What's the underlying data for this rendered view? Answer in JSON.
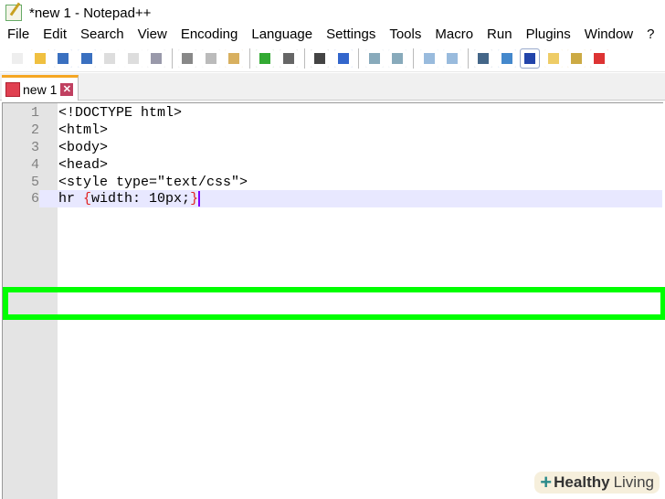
{
  "title": "*new 1 - Notepad++",
  "menu": [
    "File",
    "Edit",
    "Search",
    "View",
    "Encoding",
    "Language",
    "Settings",
    "Tools",
    "Macro",
    "Run",
    "Plugins",
    "Window",
    "?"
  ],
  "toolbar_groups": [
    [
      "new-file-icon",
      "open-file-icon",
      "save-icon",
      "save-all-icon",
      "close-icon",
      "close-all-icon",
      "print-icon"
    ],
    [
      "cut-icon",
      "copy-icon",
      "paste-icon"
    ],
    [
      "undo-icon",
      "redo-icon"
    ],
    [
      "find-icon",
      "replace-icon"
    ],
    [
      "zoom-in-icon",
      "zoom-out-icon"
    ],
    [
      "sync-vertical-icon",
      "sync-horizontal-icon"
    ],
    [
      "word-wrap-icon",
      "show-all-chars-icon",
      "indent-guide-icon",
      "doc-map-icon",
      "function-list-icon",
      "folder-workspace-icon"
    ]
  ],
  "tab": {
    "label": "new 1",
    "close": "✕"
  },
  "lines": [
    {
      "n": "1",
      "text": "<!DOCTYPE html>"
    },
    {
      "n": "2",
      "text": "<html>"
    },
    {
      "n": "3",
      "text": "<body>"
    },
    {
      "n": "4",
      "text": "<head>"
    },
    {
      "n": "5",
      "text": "<style type=\"text/css\">"
    }
  ],
  "current_line": {
    "n": "6",
    "pre": "hr ",
    "open": "{",
    "mid": "width: 10px;",
    "close": "}"
  },
  "watermark": {
    "bold": "Healthy",
    "light": "Living"
  }
}
